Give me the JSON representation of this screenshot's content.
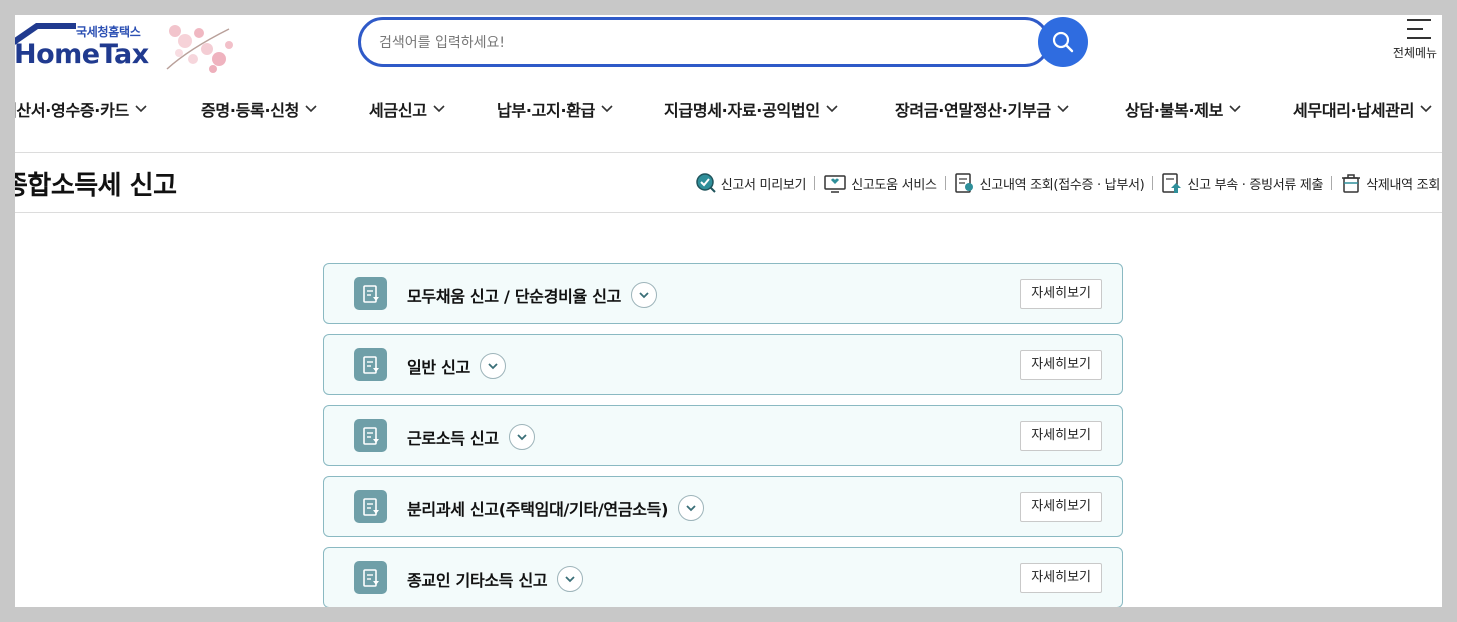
{
  "header": {
    "logo_small": "국세청홈택스",
    "logo_big": "HomeTax",
    "search_placeholder": "검색어를 입력하세요!",
    "all_menu_label": "전체메뉴"
  },
  "gnb": [
    {
      "label": "계산서·영수증·카드"
    },
    {
      "label": "증명·등록·신청"
    },
    {
      "label": "세금신고"
    },
    {
      "label": "납부·고지·환급"
    },
    {
      "label": "지급명세·자료·공익법인"
    },
    {
      "label": "장려금·연말정산·기부금"
    },
    {
      "label": "상담·불복·제보"
    },
    {
      "label": "세무대리·납세관리"
    }
  ],
  "page": {
    "title": "종합소득세 신고"
  },
  "quicklinks": [
    {
      "label": "신고서 미리보기",
      "icon": "magnifier-check-icon"
    },
    {
      "label": "신고도움 서비스",
      "icon": "monitor-help-icon"
    },
    {
      "label": "신고내역 조회(접수증 · 납부서)",
      "icon": "document-search-icon"
    },
    {
      "label": "신고 부속 · 증빙서류 제출",
      "icon": "document-upload-icon"
    },
    {
      "label": "삭제내역 조회",
      "icon": "trash-icon"
    }
  ],
  "accordions": [
    {
      "title": "모두채움 신고 / 단순경비율 신고",
      "detail_label": "자세히보기"
    },
    {
      "title": "일반 신고",
      "detail_label": "자세히보기"
    },
    {
      "title": "근로소득 신고",
      "detail_label": "자세히보기"
    },
    {
      "title": "분리과세 신고(주택임대/기타/연금소득)",
      "detail_label": "자세히보기"
    },
    {
      "title": "종교인 기타소득 신고",
      "detail_label": "자세히보기"
    }
  ],
  "colors": {
    "brand": "#203a8f",
    "search_border": "#2f5ac8",
    "search_button": "#2f6ce0",
    "accordion_bg": "#f3fbfb",
    "accordion_border": "#8ab9c2",
    "accordion_icon": "#6f9fa8"
  }
}
